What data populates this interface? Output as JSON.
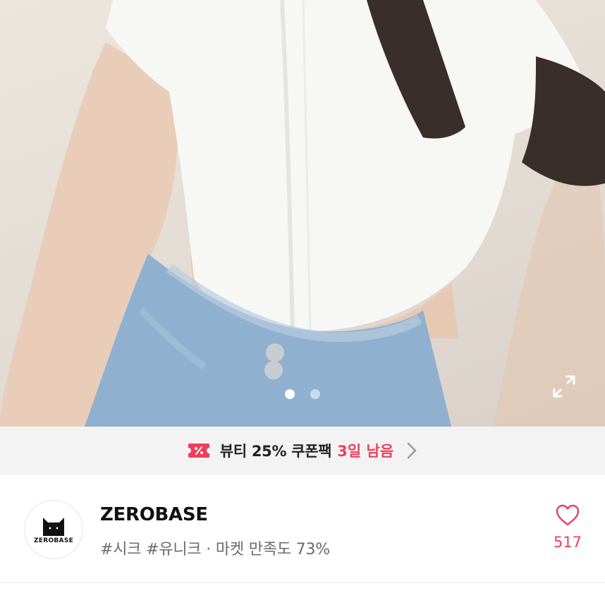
{
  "gallery": {
    "image_alt": "",
    "dot_count": 2,
    "active_index": 0,
    "expand_icon": "expand-icon"
  },
  "coupon": {
    "icon": "coupon-percent-icon",
    "text": "뷰티 25% 쿠폰팩",
    "highlight": "3일 남음",
    "highlight_color": "#ef3e5a",
    "chevron_icon": "chevron-right-icon"
  },
  "seller": {
    "logo_text": "ZEROBASE",
    "name": "ZEROBASE",
    "tags": "#시크 #유니크",
    "separator": "·",
    "satisfaction": "마켓 만족도 73%",
    "like_icon": "heart-icon",
    "like_count": "517",
    "accent": "#ef3e5a"
  }
}
